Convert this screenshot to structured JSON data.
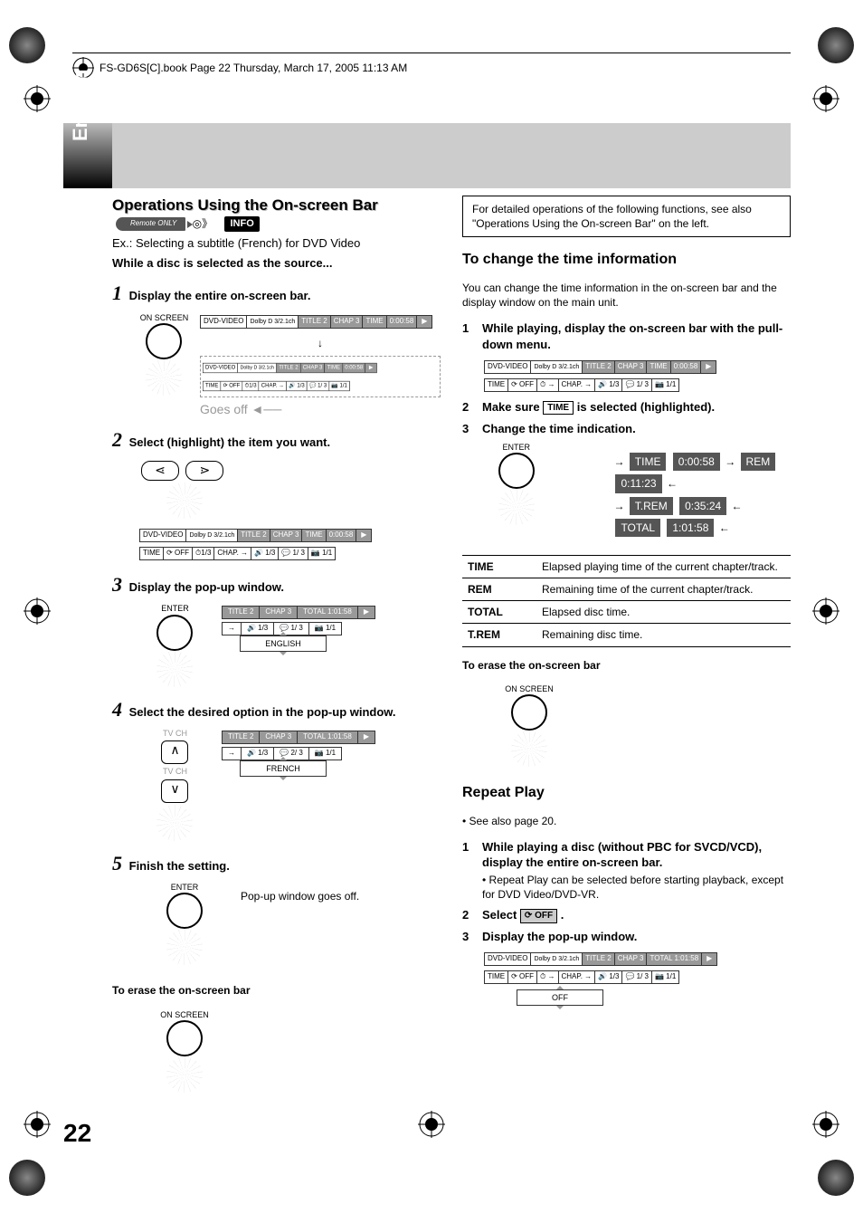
{
  "header": "FS-GD6S[C].book  Page 22  Thursday, March 17, 2005  11:13 AM",
  "english_tab": "English",
  "page_number": "22",
  "left": {
    "title": "Operations Using the On-screen Bar",
    "remote_badge": "Remote ONLY",
    "info_badge": "INFO",
    "example": "Ex.: Selecting a subtitle (French) for DVD Video",
    "while_note": "While a disc is selected as the source...",
    "step1": "Display the entire on-screen bar.",
    "on_screen_label": "ON SCREEN",
    "goes_off": "Goes off",
    "step2": "Select (highlight) the item you want.",
    "osb2": {
      "disc": "DVD-VIDEO",
      "dolby": "Dolby D 3/2.1ch",
      "title": "TITLE 2",
      "chap": "CHAP 3",
      "timelbl": "TIME",
      "time": "0:00:58",
      "row2_a": "TIME",
      "row2_b": "⟳ OFF",
      "row2_c": "⏱1/3",
      "row2_d": "CHAP. →",
      "row2_e": "🔊 1/3",
      "row2_f": "💬 1/ 3",
      "row2_g": "📷 1/1"
    },
    "step3": "Display the pop-up window.",
    "enter_label": "ENTER",
    "pop3": {
      "title": "TITLE 2",
      "chap": "CHAP 3",
      "total": "TOTAL 1:01:58",
      "r1": "🔊 1/3",
      "r2": "💬 1/ 3",
      "r3": "📷 1/1",
      "lang": "ENGLISH"
    },
    "step4": "Select the desired option in the pop-up window.",
    "tvch": "TV CH",
    "pop4": {
      "title": "TITLE 2",
      "chap": "CHAP 3",
      "total": "TOTAL 1:01:58",
      "r1": "🔊 1/3",
      "r2": "💬 2/ 3",
      "r3": "📷 1/1",
      "lang": "FRENCH"
    },
    "step5": "Finish the setting.",
    "popup_off": "Pop-up window goes off.",
    "erase_heading": "To erase the on-screen bar"
  },
  "right": {
    "note_box": "For detailed operations of the following functions, see also \"Operations Using the On-screen Bar\" on the left.",
    "sec1_title": "To change the time information",
    "sec1_body": "You can change the time information in the on-screen bar and the display window on the main unit.",
    "s1_step1": "While playing, display the on-screen bar with the pull-down menu.",
    "osb_r1": {
      "disc": "DVD-VIDEO",
      "dolby": "Dolby D 3/2.1ch",
      "title": "TITLE 2",
      "chap": "CHAP 3",
      "timelbl": "TIME",
      "time": "0:00:58",
      "row2_a": "TIME",
      "row2_b": "⟳ OFF",
      "row2_c": "⏱ →",
      "row2_d": "CHAP. →",
      "row2_e": "🔊 1/3",
      "row2_f": "💬 1/ 3",
      "row2_g": "📷 1/1"
    },
    "s1_step2_a": "Make sure ",
    "s1_step2_sym": "TIME",
    "s1_step2_b": " is selected (highlighted).",
    "s1_step3": "Change the time indication.",
    "enter_label": "ENTER",
    "chips": {
      "time_lbl": "TIME",
      "time_v": "0:00:58",
      "rem_lbl": "REM",
      "rem_v": "0:11:23",
      "trem_lbl": "T.REM",
      "trem_v": "0:35:24",
      "total_lbl": "TOTAL",
      "total_v": "1:01:58"
    },
    "defs": [
      {
        "k": "TIME",
        "v": "Elapsed playing time of the current chapter/track."
      },
      {
        "k": "REM",
        "v": "Remaining time of the current chapter/track."
      },
      {
        "k": "TOTAL",
        "v": "Elapsed disc time."
      },
      {
        "k": "T.REM",
        "v": "Remaining disc time."
      }
    ],
    "erase_heading": "To erase the on-screen bar",
    "on_screen_label": "ON SCREEN",
    "sec2_title": "Repeat Play",
    "sec2_see": "• See also page 20.",
    "s2_step1": "While playing a disc (without PBC for SVCD/VCD), display the entire on-screen bar.",
    "s2_step1_sub": "• Repeat Play can be selected before starting playback, except for DVD Video/DVD-VR.",
    "s2_step2_a": "Select ",
    "s2_step2_sym": "⟳ OFF",
    "s2_step2_b": " .",
    "s2_step3": "Display the pop-up window.",
    "osb_r2": {
      "disc": "DVD-VIDEO",
      "dolby": "Dolby D 3/2.1ch",
      "title": "TITLE 2",
      "chap": "CHAP 3",
      "total": "TOTAL 1:01:58",
      "row2_a": "TIME",
      "row2_b": "⟳ OFF",
      "row2_c": "⏱ →",
      "row2_d": "CHAP. →",
      "row2_e": "🔊 1/3",
      "row2_f": "💬 1/ 3",
      "row2_g": "📷 1/1",
      "dropdown": "OFF"
    }
  }
}
